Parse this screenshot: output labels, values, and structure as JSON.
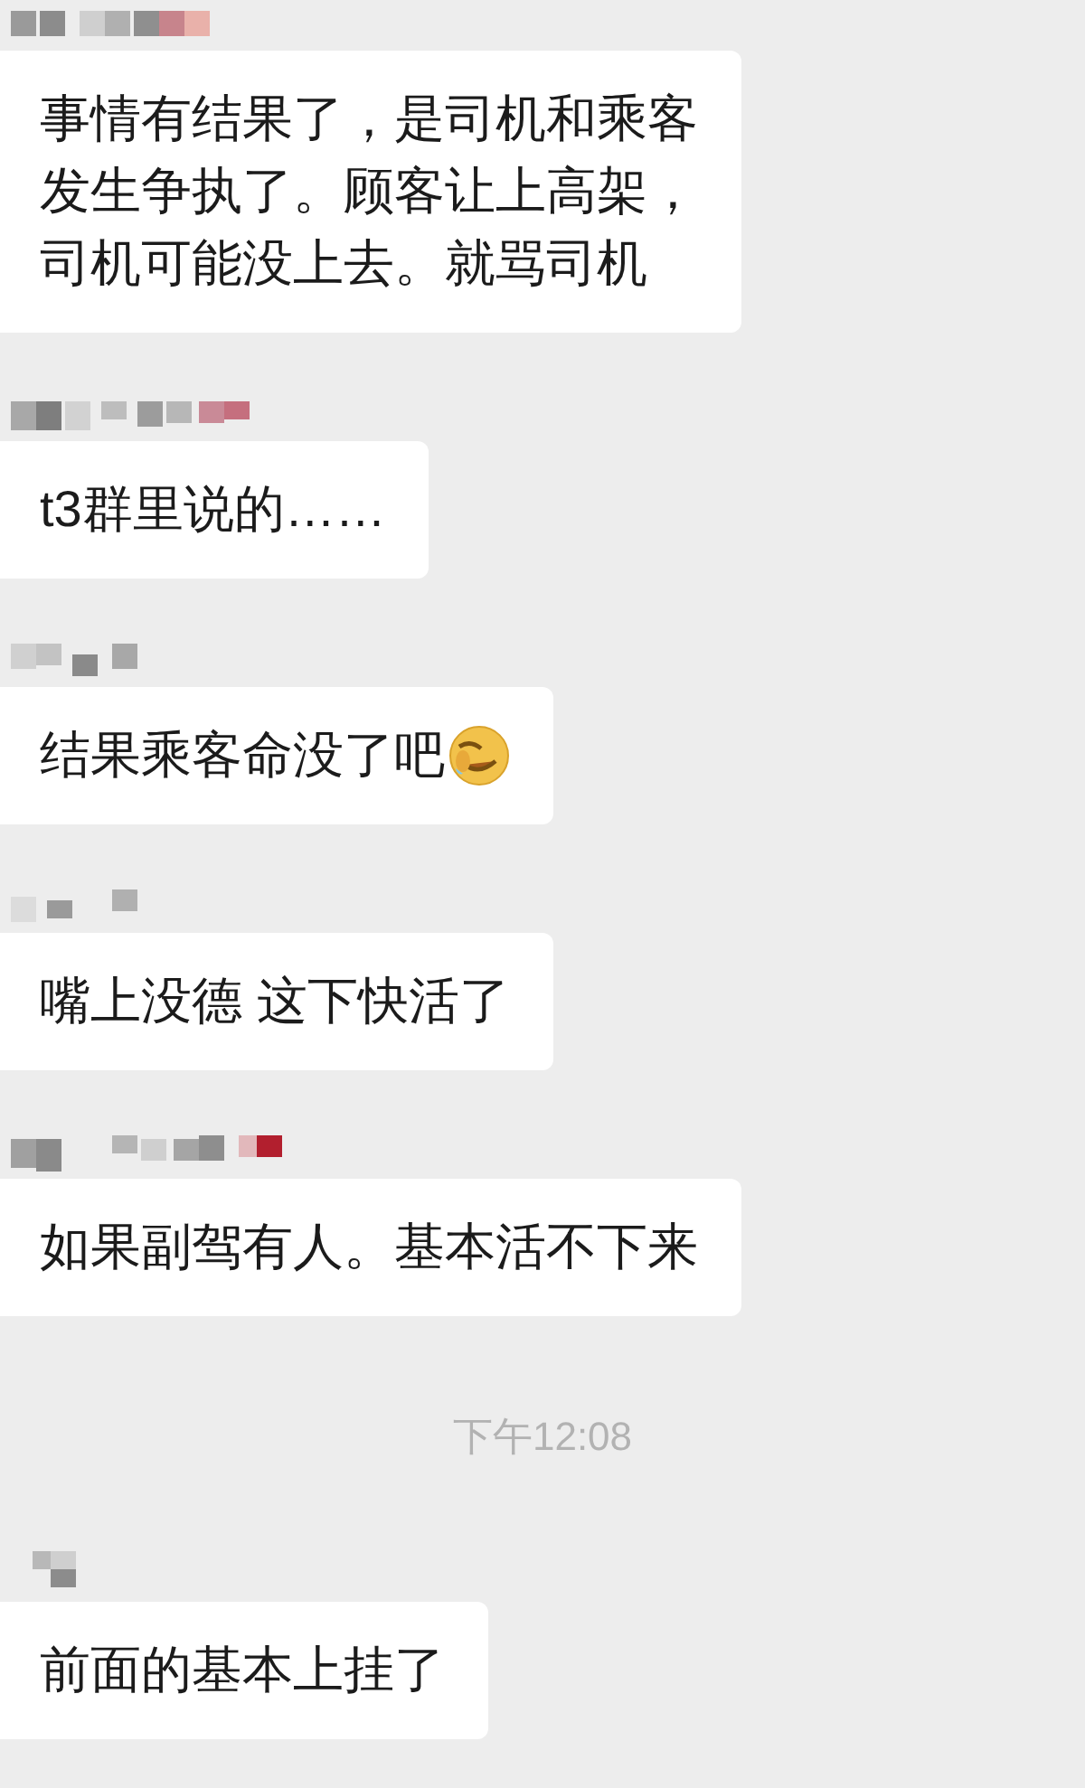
{
  "messages": [
    {
      "kind": "message",
      "name_hidden": true,
      "lines": [
        "事情有结果了，是司机和乘客",
        "发生争执了。顾客让上高架，",
        "司机可能没上去。就骂司机"
      ],
      "trailing_emoji": false
    },
    {
      "kind": "message",
      "name_hidden": true,
      "text": "t3群里说的……",
      "trailing_emoji": false
    },
    {
      "kind": "message",
      "name_hidden": true,
      "text": "结果乘客命没了吧",
      "trailing_emoji": true
    },
    {
      "kind": "message",
      "name_hidden": true,
      "text": "嘴上没德 这下快活了",
      "trailing_emoji": false
    },
    {
      "kind": "message",
      "name_hidden": true,
      "text": "如果副驾有人。基本活不下来",
      "trailing_emoji": false
    },
    {
      "kind": "time",
      "text": "下午12:08"
    },
    {
      "kind": "message",
      "name_hidden": true,
      "text": "前面的基本上挂了",
      "trailing_emoji": false
    }
  ]
}
